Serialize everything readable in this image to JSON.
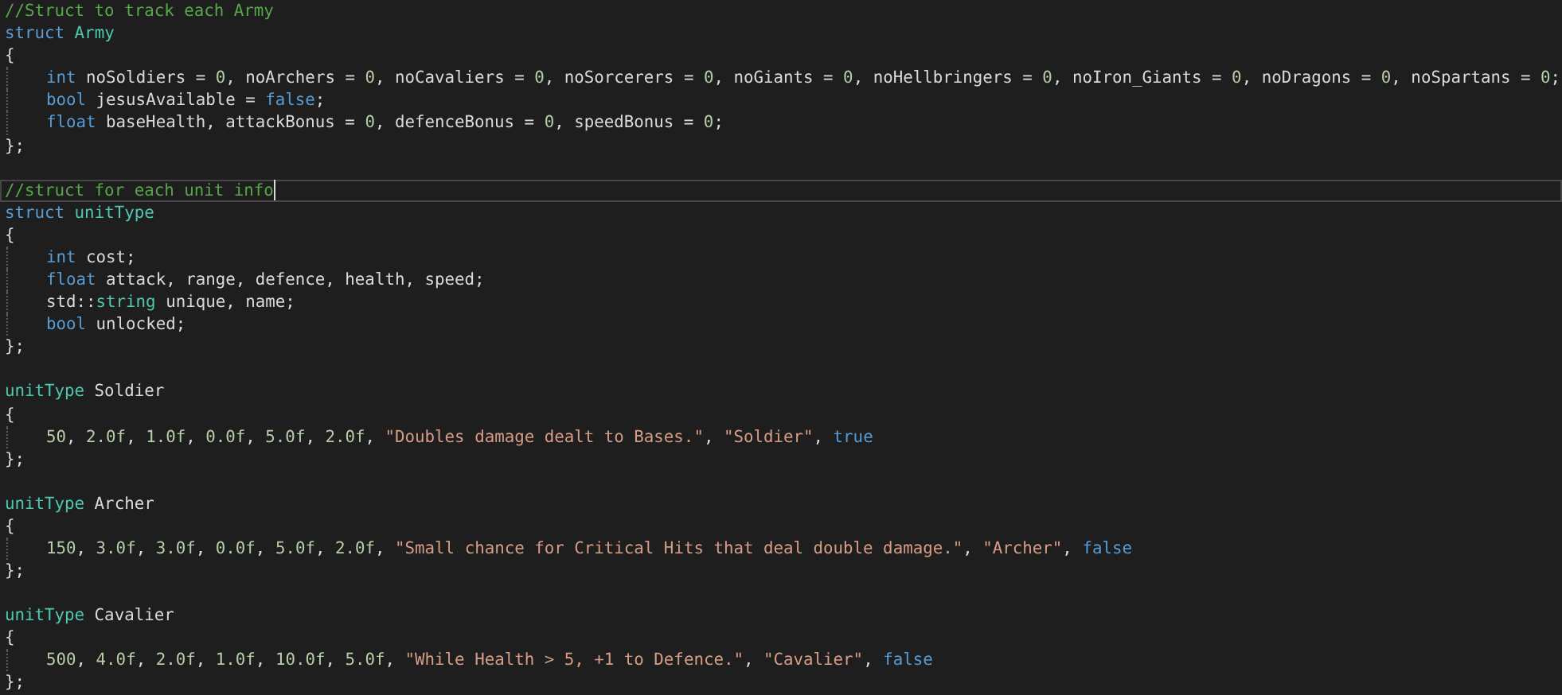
{
  "editor": {
    "blocks": [
      {
        "lines": [
          {
            "tokens": [
              {
                "kind": "comment",
                "text": "//Struct to track each Army"
              }
            ]
          },
          {
            "tokens": [
              {
                "kind": "keyword",
                "text": "struct"
              },
              {
                "kind": "type",
                "text": " Army"
              }
            ]
          },
          {
            "tokens": [
              {
                "kind": "plain",
                "text": "{"
              }
            ]
          },
          {
            "indented": true,
            "tokens": [
              {
                "kind": "keyword",
                "text": "int"
              },
              {
                "kind": "plain",
                "text": " noSoldiers = "
              },
              {
                "kind": "number",
                "text": "0"
              },
              {
                "kind": "plain",
                "text": ", noArchers = "
              },
              {
                "kind": "number",
                "text": "0"
              },
              {
                "kind": "plain",
                "text": ", noCavaliers = "
              },
              {
                "kind": "number",
                "text": "0"
              },
              {
                "kind": "plain",
                "text": ", noSorcerers = "
              },
              {
                "kind": "number",
                "text": "0"
              },
              {
                "kind": "plain",
                "text": ", noGiants = "
              },
              {
                "kind": "number",
                "text": "0"
              },
              {
                "kind": "plain",
                "text": ", noHellbringers = "
              },
              {
                "kind": "number",
                "text": "0"
              },
              {
                "kind": "plain",
                "text": ", noIron_Giants = "
              },
              {
                "kind": "number",
                "text": "0"
              },
              {
                "kind": "plain",
                "text": ", noDragons = "
              },
              {
                "kind": "number",
                "text": "0"
              },
              {
                "kind": "plain",
                "text": ", noSpartans = "
              },
              {
                "kind": "number",
                "text": "0"
              },
              {
                "kind": "plain",
                "text": ";"
              }
            ]
          },
          {
            "indented": true,
            "tokens": [
              {
                "kind": "keyword",
                "text": "bool"
              },
              {
                "kind": "plain",
                "text": " jesusAvailable = "
              },
              {
                "kind": "keyword",
                "text": "false"
              },
              {
                "kind": "plain",
                "text": ";"
              }
            ]
          },
          {
            "indented": true,
            "tokens": [
              {
                "kind": "keyword",
                "text": "float"
              },
              {
                "kind": "plain",
                "text": " baseHealth, attackBonus = "
              },
              {
                "kind": "number",
                "text": "0"
              },
              {
                "kind": "plain",
                "text": ", defenceBonus = "
              },
              {
                "kind": "number",
                "text": "0"
              },
              {
                "kind": "plain",
                "text": ", speedBonus = "
              },
              {
                "kind": "number",
                "text": "0"
              },
              {
                "kind": "plain",
                "text": ";"
              }
            ]
          },
          {
            "tokens": [
              {
                "kind": "plain",
                "text": "};"
              }
            ]
          }
        ]
      },
      {
        "lines": [
          {
            "current": true,
            "tokens": [
              {
                "kind": "comment",
                "text": "//struct for each unit info"
              }
            ]
          },
          {
            "tokens": [
              {
                "kind": "keyword",
                "text": "struct"
              },
              {
                "kind": "type",
                "text": " unitType"
              }
            ]
          },
          {
            "tokens": [
              {
                "kind": "plain",
                "text": "{"
              }
            ]
          },
          {
            "indented": true,
            "tokens": [
              {
                "kind": "keyword",
                "text": "int"
              },
              {
                "kind": "plain",
                "text": " cost;"
              }
            ]
          },
          {
            "indented": true,
            "tokens": [
              {
                "kind": "keyword",
                "text": "float"
              },
              {
                "kind": "plain",
                "text": " attack, range, defence, health, speed;"
              }
            ]
          },
          {
            "indented": true,
            "tokens": [
              {
                "kind": "plain",
                "text": "std::"
              },
              {
                "kind": "type",
                "text": "string"
              },
              {
                "kind": "plain",
                "text": " unique, name;"
              }
            ]
          },
          {
            "indented": true,
            "tokens": [
              {
                "kind": "keyword",
                "text": "bool"
              },
              {
                "kind": "plain",
                "text": " unlocked;"
              }
            ]
          },
          {
            "tokens": [
              {
                "kind": "plain",
                "text": "};"
              }
            ]
          }
        ]
      },
      {
        "lines": [
          {
            "tokens": [
              {
                "kind": "type",
                "text": "unitType"
              },
              {
                "kind": "plain",
                "text": " Soldier"
              }
            ]
          },
          {
            "tokens": [
              {
                "kind": "plain",
                "text": "{"
              }
            ]
          },
          {
            "indented": true,
            "tokens": [
              {
                "kind": "number",
                "text": "50"
              },
              {
                "kind": "plain",
                "text": ", "
              },
              {
                "kind": "number",
                "text": "2.0f"
              },
              {
                "kind": "plain",
                "text": ", "
              },
              {
                "kind": "number",
                "text": "1.0f"
              },
              {
                "kind": "plain",
                "text": ", "
              },
              {
                "kind": "number",
                "text": "0.0f"
              },
              {
                "kind": "plain",
                "text": ", "
              },
              {
                "kind": "number",
                "text": "5.0f"
              },
              {
                "kind": "plain",
                "text": ", "
              },
              {
                "kind": "number",
                "text": "2.0f"
              },
              {
                "kind": "plain",
                "text": ", "
              },
              {
                "kind": "string",
                "text": "\"Doubles damage dealt to Bases.\""
              },
              {
                "kind": "plain",
                "text": ", "
              },
              {
                "kind": "string",
                "text": "\"Soldier\""
              },
              {
                "kind": "plain",
                "text": ", "
              },
              {
                "kind": "keyword",
                "text": "true"
              }
            ]
          },
          {
            "tokens": [
              {
                "kind": "plain",
                "text": "};"
              }
            ]
          }
        ]
      },
      {
        "lines": [
          {
            "tokens": [
              {
                "kind": "type",
                "text": "unitType"
              },
              {
                "kind": "plain",
                "text": " Archer"
              }
            ]
          },
          {
            "tokens": [
              {
                "kind": "plain",
                "text": "{"
              }
            ]
          },
          {
            "indented": true,
            "tokens": [
              {
                "kind": "number",
                "text": "150"
              },
              {
                "kind": "plain",
                "text": ", "
              },
              {
                "kind": "number",
                "text": "3.0f"
              },
              {
                "kind": "plain",
                "text": ", "
              },
              {
                "kind": "number",
                "text": "3.0f"
              },
              {
                "kind": "plain",
                "text": ", "
              },
              {
                "kind": "number",
                "text": "0.0f"
              },
              {
                "kind": "plain",
                "text": ", "
              },
              {
                "kind": "number",
                "text": "5.0f"
              },
              {
                "kind": "plain",
                "text": ", "
              },
              {
                "kind": "number",
                "text": "2.0f"
              },
              {
                "kind": "plain",
                "text": ", "
              },
              {
                "kind": "string",
                "text": "\"Small chance for Critical Hits that deal double damage.\""
              },
              {
                "kind": "plain",
                "text": ", "
              },
              {
                "kind": "string",
                "text": "\"Archer\""
              },
              {
                "kind": "plain",
                "text": ", "
              },
              {
                "kind": "keyword",
                "text": "false"
              }
            ]
          },
          {
            "tokens": [
              {
                "kind": "plain",
                "text": "};"
              }
            ]
          }
        ]
      },
      {
        "lines": [
          {
            "tokens": [
              {
                "kind": "type",
                "text": "unitType"
              },
              {
                "kind": "plain",
                "text": " Cavalier"
              }
            ]
          },
          {
            "tokens": [
              {
                "kind": "plain",
                "text": "{"
              }
            ]
          },
          {
            "indented": true,
            "tokens": [
              {
                "kind": "number",
                "text": "500"
              },
              {
                "kind": "plain",
                "text": ", "
              },
              {
                "kind": "number",
                "text": "4.0f"
              },
              {
                "kind": "plain",
                "text": ", "
              },
              {
                "kind": "number",
                "text": "2.0f"
              },
              {
                "kind": "plain",
                "text": ", "
              },
              {
                "kind": "number",
                "text": "1.0f"
              },
              {
                "kind": "plain",
                "text": ", "
              },
              {
                "kind": "number",
                "text": "10.0f"
              },
              {
                "kind": "plain",
                "text": ", "
              },
              {
                "kind": "number",
                "text": "5.0f"
              },
              {
                "kind": "plain",
                "text": ", "
              },
              {
                "kind": "string",
                "text": "\"While Health > 5, +1 to Defence.\""
              },
              {
                "kind": "plain",
                "text": ", "
              },
              {
                "kind": "string",
                "text": "\"Cavalier\""
              },
              {
                "kind": "plain",
                "text": ", "
              },
              {
                "kind": "keyword",
                "text": "false"
              }
            ]
          },
          {
            "tokens": [
              {
                "kind": "plain",
                "text": "};"
              }
            ]
          }
        ]
      }
    ]
  }
}
